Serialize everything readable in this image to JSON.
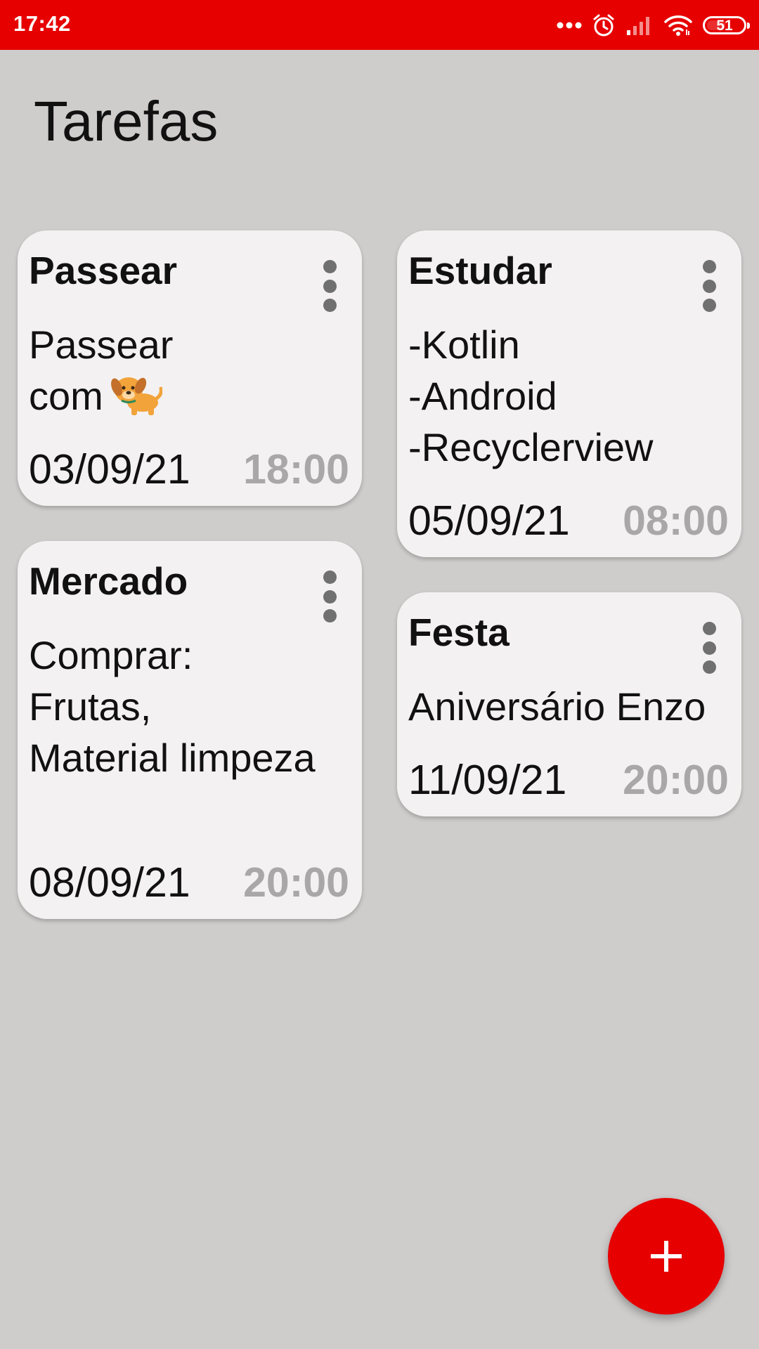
{
  "status_bar": {
    "time": "17:42",
    "battery": "51",
    "battery_level": 0.51,
    "icons": [
      "more-dots-icon",
      "alarm-icon",
      "signal-icon",
      "wifi-icon",
      "battery-icon"
    ]
  },
  "header": {
    "title": "Tarefas"
  },
  "tasks": [
    {
      "title": "Passear",
      "body": "Passear\ncom",
      "emoji": "dog-emoji",
      "date": "03/09/21",
      "time": "18:00"
    },
    {
      "title": "Estudar",
      "body": "-Kotlin\n-Android\n-Recyclerview",
      "date": "05/09/21",
      "time": "08:00"
    },
    {
      "title": "Mercado",
      "body": "Comprar:\nFrutas,\nMaterial limpeza",
      "date": "08/09/21",
      "time": "20:00"
    },
    {
      "title": "Festa",
      "body": "Aniversário Enzo",
      "date": "11/09/21",
      "time": "20:00"
    }
  ],
  "fab": {
    "icon": "plus-icon"
  },
  "colors": {
    "accent": "#e60000",
    "background": "#cfcccc",
    "card": "#f3f1f1",
    "time_text": "#a9a7a7",
    "menu_dots": "#707070"
  }
}
